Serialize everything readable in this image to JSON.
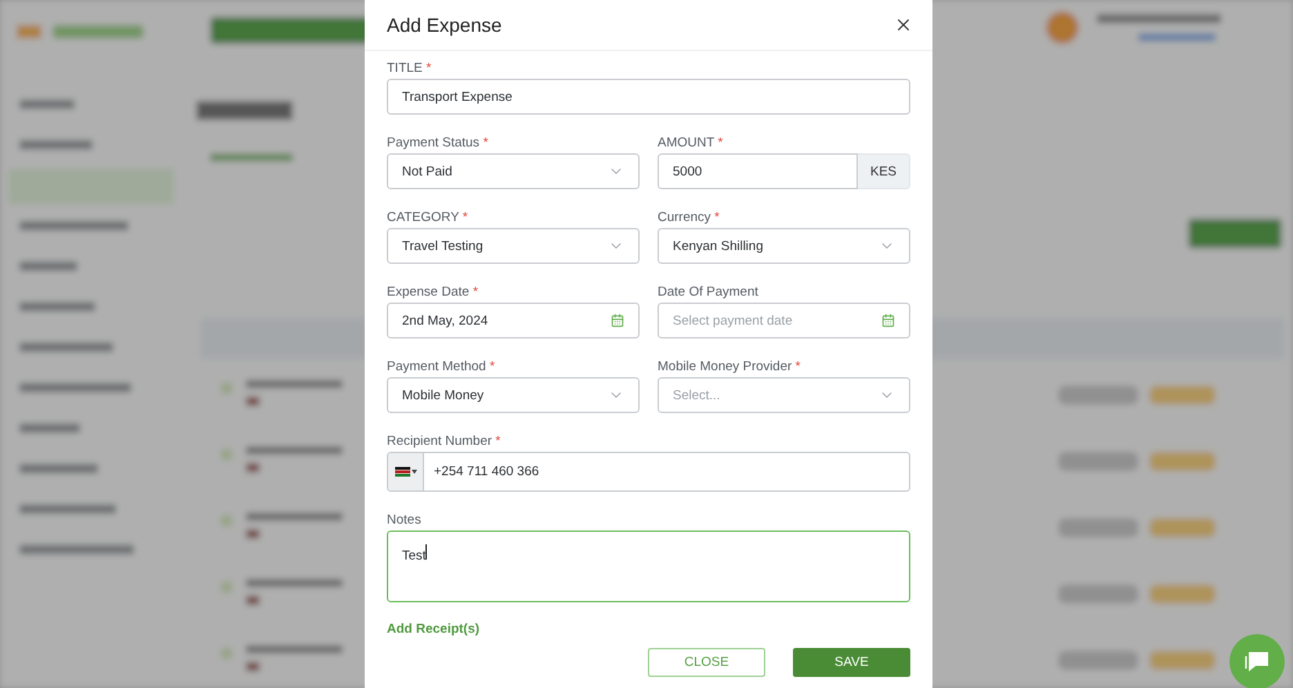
{
  "dialog": {
    "title": "Add Expense",
    "rows": [
      [
        {
          "kind": "text",
          "label": "TITLE",
          "required_mark": "*",
          "value": "Transport Expense"
        }
      ],
      [
        {
          "kind": "select",
          "label": "Payment Status",
          "required_mark": "*",
          "value": "Not Paid"
        },
        {
          "kind": "amount",
          "label": "AMOUNT",
          "required_mark": "*",
          "value": "5000",
          "addon": "KES"
        }
      ],
      [
        {
          "kind": "select",
          "label": "CATEGORY",
          "required_mark": "*",
          "value": "Travel Testing"
        },
        {
          "kind": "select",
          "label": "Currency",
          "required_mark": "*",
          "value": "Kenyan Shilling"
        }
      ],
      [
        {
          "kind": "date",
          "label": "Expense Date",
          "required_mark": "*",
          "value": "2nd May, 2024"
        },
        {
          "kind": "date",
          "label": "Date Of Payment",
          "placeholder": "Select payment date"
        }
      ],
      [
        {
          "kind": "select",
          "label": "Payment Method",
          "required_mark": "*",
          "value": "Mobile Money"
        },
        {
          "kind": "select",
          "label": "Mobile Money Provider",
          "required_mark": "*",
          "placeholder": "Select..."
        }
      ],
      [
        {
          "kind": "phone",
          "label": "Recipient Number",
          "required_mark": "*",
          "value": "+254 711 460 366"
        }
      ],
      [
        {
          "kind": "textarea",
          "label": "Notes",
          "value": "Test",
          "focused": true
        }
      ]
    ],
    "link": "Add Receipt(s)",
    "buttons": [
      {
        "label": "CLOSE",
        "kind": "outline"
      },
      {
        "label": "SAVE",
        "kind": "primary"
      }
    ]
  }
}
